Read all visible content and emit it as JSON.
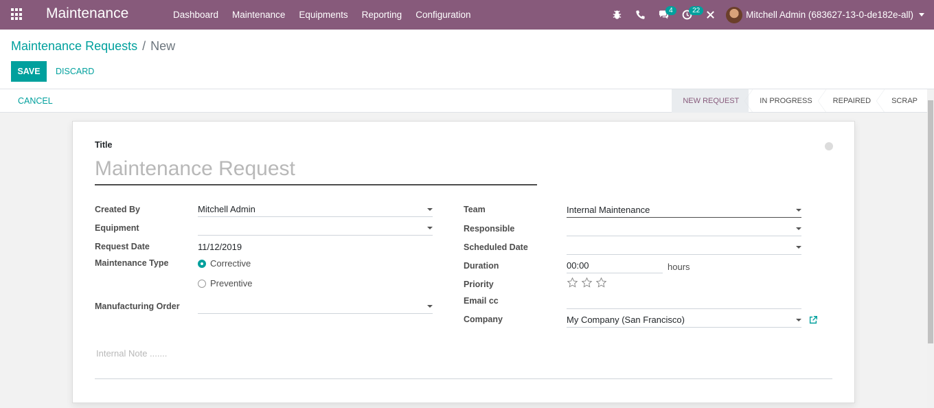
{
  "navbar": {
    "app_title": "Maintenance",
    "menu": [
      "Dashboard",
      "Maintenance",
      "Equipments",
      "Reporting",
      "Configuration"
    ],
    "messages_count": "4",
    "activities_count": "22",
    "user_name": "Mitchell Admin (683627-13-0-de182e-all)",
    "icons": [
      "apps-icon",
      "bug-icon",
      "phone-icon",
      "chat-icon",
      "clock-icon",
      "close-tools-icon",
      "avatar"
    ]
  },
  "breadcrumb": {
    "parent": "Maintenance Requests",
    "separator": "/",
    "current": "New"
  },
  "buttons": {
    "save": "SAVE",
    "discard": "DISCARD",
    "cancel": "CANCEL"
  },
  "stages": [
    "NEW REQUEST",
    "IN PROGRESS",
    "REPAIRED",
    "SCRAP"
  ],
  "form": {
    "title_label": "Title",
    "title_placeholder": "Maintenance Request",
    "left": {
      "created_by_label": "Created By",
      "created_by_value": "Mitchell Admin",
      "equipment_label": "Equipment",
      "equipment_value": "",
      "request_date_label": "Request Date",
      "request_date_value": "11/12/2019",
      "maintenance_type_label": "Maintenance Type",
      "type_corrective": "Corrective",
      "type_preventive": "Preventive",
      "manufacturing_order_label": "Manufacturing Order",
      "manufacturing_order_value": ""
    },
    "right": {
      "team_label": "Team",
      "team_value": "Internal Maintenance",
      "responsible_label": "Responsible",
      "responsible_value": "",
      "scheduled_date_label": "Scheduled Date",
      "scheduled_date_value": "",
      "duration_label": "Duration",
      "duration_value": "00:00",
      "duration_unit": "hours",
      "priority_label": "Priority",
      "email_cc_label": "Email cc",
      "email_cc_value": "",
      "company_label": "Company",
      "company_value": "My Company (San Francisco)"
    },
    "note_placeholder": "Internal Note ......."
  },
  "colors": {
    "navbar": "#875a7b",
    "accent": "#00a09d"
  }
}
